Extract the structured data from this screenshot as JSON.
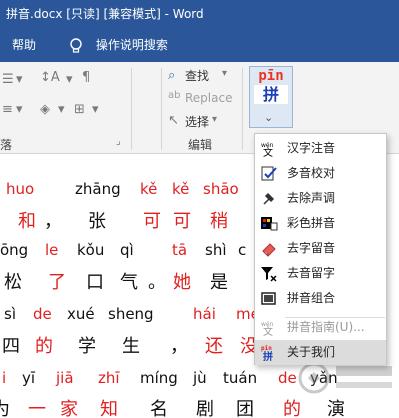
{
  "window": {
    "title": "拼音.docx [只读] [兼容模式] - Word"
  },
  "menubar": {
    "help": "帮助",
    "tell_me": "操作说明搜索"
  },
  "ribbon": {
    "find": "查找",
    "replace": "Replace",
    "select": "选择",
    "group_paragraph": "落",
    "group_edit": "编辑",
    "pinyin_top": "pīn",
    "pinyin_char": "拼"
  },
  "document": {
    "lines": [
      {
        "kind": "pinyin",
        "tokens": [
          {
            "t": "huo",
            "c": "r"
          },
          {
            "t": "zhāng",
            "c": "b"
          },
          {
            "t": "kě",
            "c": "r"
          },
          {
            "t": "kě",
            "c": "r"
          },
          {
            "t": "shāo",
            "c": "r"
          }
        ]
      },
      {
        "kind": "hanzi",
        "tokens": [
          {
            "t": "和",
            "c": "r"
          },
          {
            "t": "，",
            "c": "b"
          },
          {
            "t": "张",
            "c": "b"
          },
          {
            "t": "可",
            "c": "r"
          },
          {
            "t": "可",
            "c": "r"
          },
          {
            "t": "稍",
            "c": "r"
          }
        ]
      },
      {
        "kind": "pinyin",
        "tokens": [
          {
            "t": "ōng",
            "c": "b"
          },
          {
            "t": "le",
            "c": "r"
          },
          {
            "t": "kǒu",
            "c": "b"
          },
          {
            "t": "qì",
            "c": "b"
          },
          {
            "t": "tā",
            "c": "r"
          },
          {
            "t": "shì",
            "c": "b"
          },
          {
            "t": "c",
            "c": "b"
          }
        ]
      },
      {
        "kind": "hanzi",
        "tokens": [
          {
            "t": "松",
            "c": "b"
          },
          {
            "t": "了",
            "c": "r"
          },
          {
            "t": "口",
            "c": "b"
          },
          {
            "t": "气",
            "c": "b"
          },
          {
            "t": "。",
            "c": "b"
          },
          {
            "t": "她",
            "c": "r"
          },
          {
            "t": "是",
            "c": "b"
          }
        ]
      },
      {
        "kind": "pinyin",
        "tokens": [
          {
            "t": "sì",
            "c": "b"
          },
          {
            "t": "de",
            "c": "r"
          },
          {
            "t": "xué",
            "c": "b"
          },
          {
            "t": "sheng",
            "c": "b"
          },
          {
            "t": "hái",
            "c": "r"
          },
          {
            "t": "mé",
            "c": "r"
          }
        ]
      },
      {
        "kind": "hanzi",
        "tokens": [
          {
            "t": "四",
            "c": "b"
          },
          {
            "t": "的",
            "c": "r"
          },
          {
            "t": "学",
            "c": "b"
          },
          {
            "t": "生",
            "c": "b"
          },
          {
            "t": "，",
            "c": "b"
          },
          {
            "t": "还",
            "c": "r"
          },
          {
            "t": "没",
            "c": "r"
          }
        ]
      },
      {
        "kind": "pinyin",
        "tokens": [
          {
            "t": "i",
            "c": "r"
          },
          {
            "t": "yī",
            "c": "b"
          },
          {
            "t": "jiā",
            "c": "r"
          },
          {
            "t": "zhī",
            "c": "r"
          },
          {
            "t": "míng",
            "c": "b"
          },
          {
            "t": "jù",
            "c": "b"
          },
          {
            "t": "tuán",
            "c": "b"
          },
          {
            "t": "de",
            "c": "r"
          },
          {
            "t": "yǎn",
            "c": "b"
          }
        ]
      },
      {
        "kind": "hanzi",
        "tokens": [
          {
            "t": "为",
            "c": "b"
          },
          {
            "t": "一",
            "c": "r"
          },
          {
            "t": "家",
            "c": "r"
          },
          {
            "t": "知",
            "c": "r"
          },
          {
            "t": "名",
            "c": "b"
          },
          {
            "t": "剧",
            "c": "b"
          },
          {
            "t": "团",
            "c": "b"
          },
          {
            "t": "的",
            "c": "r"
          },
          {
            "t": "演",
            "c": "b"
          }
        ]
      }
    ]
  },
  "dropdown": {
    "items": [
      {
        "label": "汉字注音",
        "icon": "wen-zi-annotate-icon",
        "disabled": false
      },
      {
        "label": "多音校对",
        "icon": "check-proof-icon",
        "disabled": false
      },
      {
        "label": "去除声调",
        "icon": "pin-tone-icon",
        "disabled": false
      },
      {
        "label": "彩色拼音",
        "icon": "color-pinyin-icon",
        "disabled": false
      },
      {
        "label": "去字留音",
        "icon": "eraser-icon",
        "disabled": false
      },
      {
        "label": "去音留字",
        "icon": "filter-icon",
        "disabled": false
      },
      {
        "label": "拼音组合",
        "icon": "combine-icon",
        "disabled": false
      },
      {
        "label": "拼音指南(U)...",
        "icon": "wen-guide-icon",
        "disabled": true
      },
      {
        "label": "关于我们",
        "icon": "about-pinyin-icon",
        "disabled": false
      }
    ]
  },
  "colors": {
    "accent": "#2b579a",
    "pinyin_red": "#e02020",
    "pinyin_blue": "#1a3fb8"
  }
}
